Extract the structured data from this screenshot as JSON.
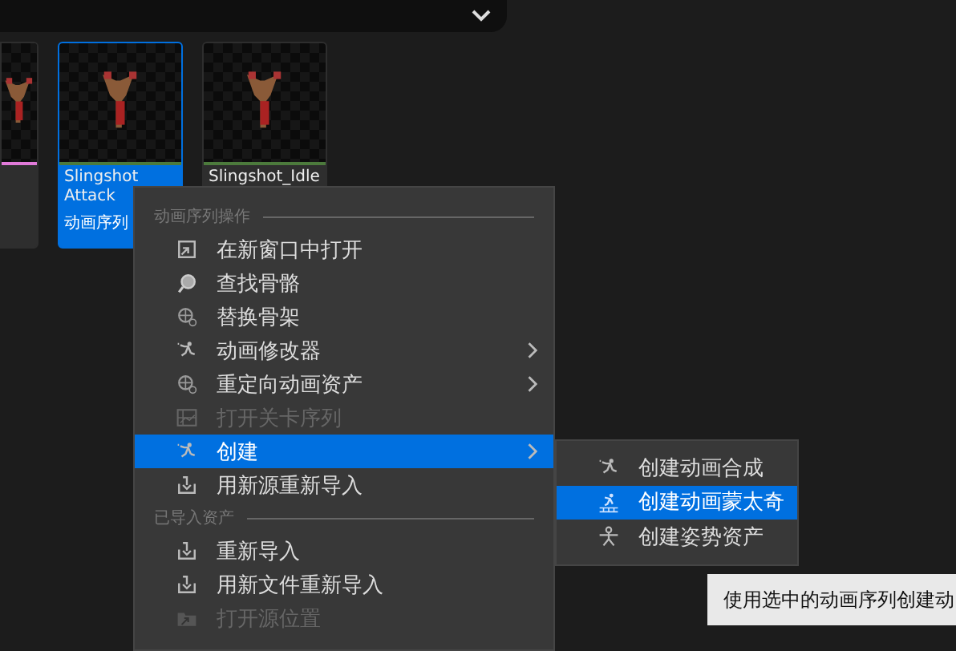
{
  "asset_cards": [
    {
      "selected": false,
      "color": "#e07ad8"
    },
    {
      "title": "Slingshot Attack",
      "type_label": "动画序列",
      "selected": true,
      "color": "#4c7a3c"
    },
    {
      "title": "Slingshot_Idle",
      "selected": false,
      "color": "#4c7a3c"
    }
  ],
  "context_menu": {
    "sections": [
      {
        "header": "动画序列操作",
        "items": [
          {
            "label": "在新窗口中打开",
            "disabled": false,
            "submenu": false,
            "selected": false
          },
          {
            "label": "查找骨骼",
            "disabled": false,
            "submenu": false,
            "selected": false
          },
          {
            "label": "替换骨架",
            "disabled": false,
            "submenu": false,
            "selected": false
          },
          {
            "label": "动画修改器",
            "disabled": false,
            "submenu": true,
            "selected": false
          },
          {
            "label": "重定向动画资产",
            "disabled": false,
            "submenu": true,
            "selected": false
          },
          {
            "label": "打开关卡序列",
            "disabled": true,
            "submenu": false,
            "selected": false
          },
          {
            "label": "创建",
            "disabled": false,
            "submenu": true,
            "selected": true
          },
          {
            "label": "用新源重新导入",
            "disabled": false,
            "submenu": false,
            "selected": false
          }
        ]
      },
      {
        "header": "已导入资产",
        "items": [
          {
            "label": "重新导入",
            "disabled": false,
            "submenu": false,
            "selected": false
          },
          {
            "label": "用新文件重新导入",
            "disabled": false,
            "submenu": false,
            "selected": false
          },
          {
            "label": "打开源位置",
            "disabled": true,
            "submenu": false,
            "selected": false
          }
        ]
      }
    ]
  },
  "submenu": {
    "items": [
      {
        "label": "创建动画合成",
        "selected": false
      },
      {
        "label": "创建动画蒙太奇",
        "selected": true
      },
      {
        "label": "创建姿势资产",
        "selected": false
      }
    ]
  },
  "tooltip": {
    "text": "使用选中的动画序列创建动"
  }
}
